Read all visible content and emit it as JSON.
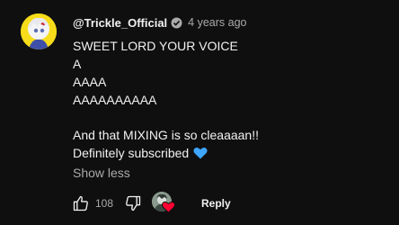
{
  "comment": {
    "author": "@Trickle_Official",
    "timestamp": "4 years ago",
    "lines": [
      "SWEET LORD YOUR VOICE",
      "A",
      "AAAA",
      "AAAAAAAAAA",
      "",
      "And that MIXING is so cleaaaan!!",
      "Definitely subscribed"
    ],
    "emoji": "blue-heart-icon",
    "show_less_label": "Show less"
  },
  "actions": {
    "like_count": "108",
    "reply_label": "Reply"
  },
  "colors": {
    "background": "#0f0f0f",
    "text": "#f1f1f1",
    "secondary": "#aaaaaa",
    "avatar_bg": "#f6dc1a",
    "blue_heart": "#3ea6ff",
    "red_heart": "#ff0033"
  }
}
